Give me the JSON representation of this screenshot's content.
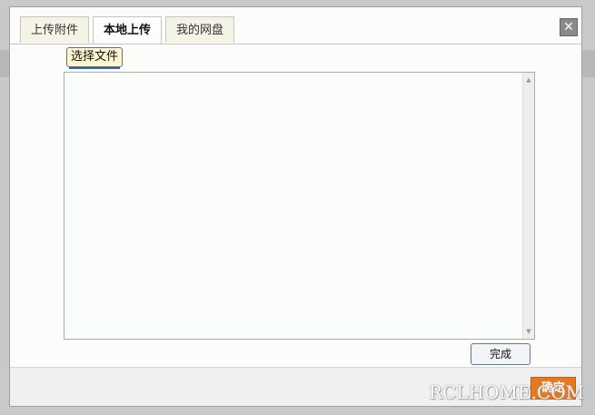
{
  "dialog": {
    "close_symbol": "✕",
    "tabs": [
      {
        "label": "上传附件",
        "active": false
      },
      {
        "label": "本地上传",
        "active": true
      },
      {
        "label": "我的网盘",
        "active": false
      }
    ],
    "choose_file_label": "选择文件",
    "scroll_up_symbol": "▲",
    "scroll_down_symbol": "▼",
    "done_label": "完成",
    "ok_label": "确定"
  },
  "watermark": "RCLHOME.COM",
  "colors": {
    "accent": "#e5791f",
    "tab_bg": "#f5f2e6",
    "file_button_bg": "#fff6cf"
  }
}
